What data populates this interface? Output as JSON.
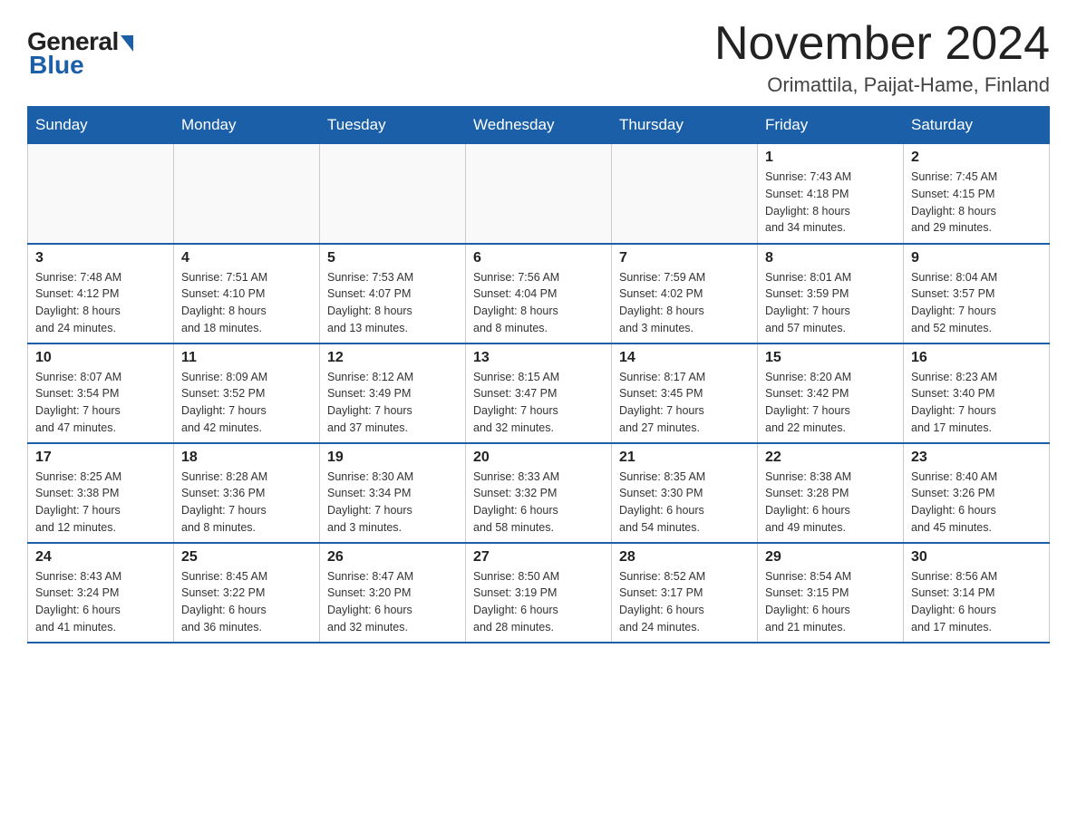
{
  "logo": {
    "general": "General",
    "blue": "Blue"
  },
  "title": "November 2024",
  "subtitle": "Orimattila, Paijat-Hame, Finland",
  "days_header": [
    "Sunday",
    "Monday",
    "Tuesday",
    "Wednesday",
    "Thursday",
    "Friday",
    "Saturday"
  ],
  "weeks": [
    [
      {
        "day": "",
        "info": ""
      },
      {
        "day": "",
        "info": ""
      },
      {
        "day": "",
        "info": ""
      },
      {
        "day": "",
        "info": ""
      },
      {
        "day": "",
        "info": ""
      },
      {
        "day": "1",
        "info": "Sunrise: 7:43 AM\nSunset: 4:18 PM\nDaylight: 8 hours\nand 34 minutes."
      },
      {
        "day": "2",
        "info": "Sunrise: 7:45 AM\nSunset: 4:15 PM\nDaylight: 8 hours\nand 29 minutes."
      }
    ],
    [
      {
        "day": "3",
        "info": "Sunrise: 7:48 AM\nSunset: 4:12 PM\nDaylight: 8 hours\nand 24 minutes."
      },
      {
        "day": "4",
        "info": "Sunrise: 7:51 AM\nSunset: 4:10 PM\nDaylight: 8 hours\nand 18 minutes."
      },
      {
        "day": "5",
        "info": "Sunrise: 7:53 AM\nSunset: 4:07 PM\nDaylight: 8 hours\nand 13 minutes."
      },
      {
        "day": "6",
        "info": "Sunrise: 7:56 AM\nSunset: 4:04 PM\nDaylight: 8 hours\nand 8 minutes."
      },
      {
        "day": "7",
        "info": "Sunrise: 7:59 AM\nSunset: 4:02 PM\nDaylight: 8 hours\nand 3 minutes."
      },
      {
        "day": "8",
        "info": "Sunrise: 8:01 AM\nSunset: 3:59 PM\nDaylight: 7 hours\nand 57 minutes."
      },
      {
        "day": "9",
        "info": "Sunrise: 8:04 AM\nSunset: 3:57 PM\nDaylight: 7 hours\nand 52 minutes."
      }
    ],
    [
      {
        "day": "10",
        "info": "Sunrise: 8:07 AM\nSunset: 3:54 PM\nDaylight: 7 hours\nand 47 minutes."
      },
      {
        "day": "11",
        "info": "Sunrise: 8:09 AM\nSunset: 3:52 PM\nDaylight: 7 hours\nand 42 minutes."
      },
      {
        "day": "12",
        "info": "Sunrise: 8:12 AM\nSunset: 3:49 PM\nDaylight: 7 hours\nand 37 minutes."
      },
      {
        "day": "13",
        "info": "Sunrise: 8:15 AM\nSunset: 3:47 PM\nDaylight: 7 hours\nand 32 minutes."
      },
      {
        "day": "14",
        "info": "Sunrise: 8:17 AM\nSunset: 3:45 PM\nDaylight: 7 hours\nand 27 minutes."
      },
      {
        "day": "15",
        "info": "Sunrise: 8:20 AM\nSunset: 3:42 PM\nDaylight: 7 hours\nand 22 minutes."
      },
      {
        "day": "16",
        "info": "Sunrise: 8:23 AM\nSunset: 3:40 PM\nDaylight: 7 hours\nand 17 minutes."
      }
    ],
    [
      {
        "day": "17",
        "info": "Sunrise: 8:25 AM\nSunset: 3:38 PM\nDaylight: 7 hours\nand 12 minutes."
      },
      {
        "day": "18",
        "info": "Sunrise: 8:28 AM\nSunset: 3:36 PM\nDaylight: 7 hours\nand 8 minutes."
      },
      {
        "day": "19",
        "info": "Sunrise: 8:30 AM\nSunset: 3:34 PM\nDaylight: 7 hours\nand 3 minutes."
      },
      {
        "day": "20",
        "info": "Sunrise: 8:33 AM\nSunset: 3:32 PM\nDaylight: 6 hours\nand 58 minutes."
      },
      {
        "day": "21",
        "info": "Sunrise: 8:35 AM\nSunset: 3:30 PM\nDaylight: 6 hours\nand 54 minutes."
      },
      {
        "day": "22",
        "info": "Sunrise: 8:38 AM\nSunset: 3:28 PM\nDaylight: 6 hours\nand 49 minutes."
      },
      {
        "day": "23",
        "info": "Sunrise: 8:40 AM\nSunset: 3:26 PM\nDaylight: 6 hours\nand 45 minutes."
      }
    ],
    [
      {
        "day": "24",
        "info": "Sunrise: 8:43 AM\nSunset: 3:24 PM\nDaylight: 6 hours\nand 41 minutes."
      },
      {
        "day": "25",
        "info": "Sunrise: 8:45 AM\nSunset: 3:22 PM\nDaylight: 6 hours\nand 36 minutes."
      },
      {
        "day": "26",
        "info": "Sunrise: 8:47 AM\nSunset: 3:20 PM\nDaylight: 6 hours\nand 32 minutes."
      },
      {
        "day": "27",
        "info": "Sunrise: 8:50 AM\nSunset: 3:19 PM\nDaylight: 6 hours\nand 28 minutes."
      },
      {
        "day": "28",
        "info": "Sunrise: 8:52 AM\nSunset: 3:17 PM\nDaylight: 6 hours\nand 24 minutes."
      },
      {
        "day": "29",
        "info": "Sunrise: 8:54 AM\nSunset: 3:15 PM\nDaylight: 6 hours\nand 21 minutes."
      },
      {
        "day": "30",
        "info": "Sunrise: 8:56 AM\nSunset: 3:14 PM\nDaylight: 6 hours\nand 17 minutes."
      }
    ]
  ]
}
